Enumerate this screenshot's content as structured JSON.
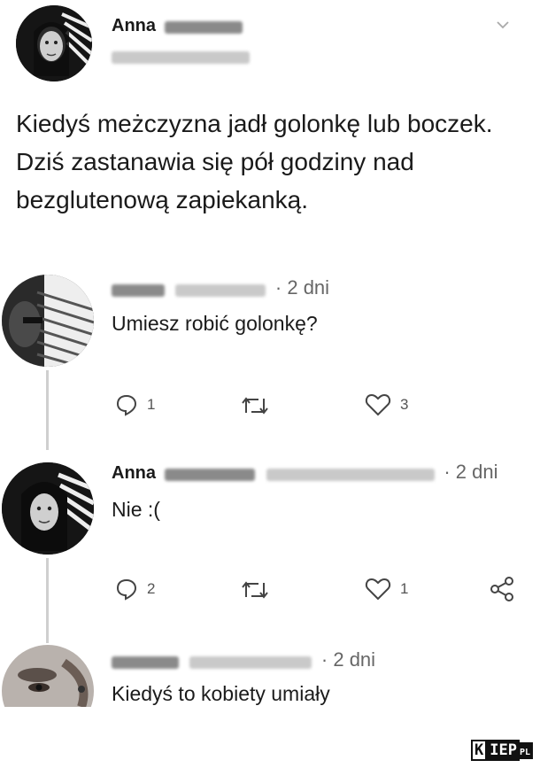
{
  "main_tweet": {
    "author_first_name": "Anna",
    "text": "Kiedyś meżczyzna jadł golonkę lub boczek. Dziś zastanawia się pół godziny nad bezglutenową zapiekanką."
  },
  "replies": [
    {
      "time": "· 2 dni",
      "text": "Umiesz robić golonkę?",
      "reply_count": "1",
      "like_count": "3"
    },
    {
      "author_first_name": "Anna",
      "time": "· 2 dni",
      "text": "Nie :(",
      "reply_count": "2",
      "like_count": "1"
    },
    {
      "time": "· 2 dni",
      "text": "Kiedyś to kobiety umiały"
    }
  ],
  "watermark": {
    "left": "K",
    "right": "IEP",
    "suffix": "PL"
  },
  "icons": {
    "chevron": "chevron-down-icon",
    "reply": "reply-icon",
    "retweet": "retweet-icon",
    "like": "heart-icon",
    "share": "share-icon"
  }
}
